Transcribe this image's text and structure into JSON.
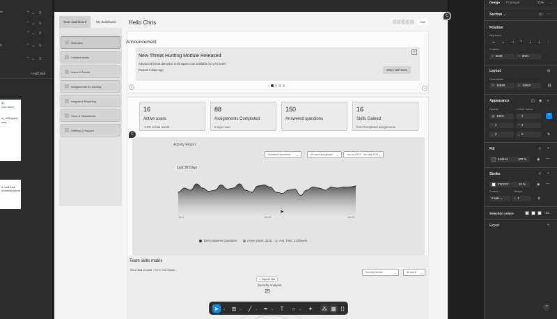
{
  "left_panel": {
    "add_task": "+ Add task",
    "fragments": [
      "sh",
      "",
      "",
      "",
      ""
    ]
  },
  "doc_snippets": {
    "first": [
      "3).",
      "over time),",
      "",
      "s), skill gaps),",
      "ress."
    ],
    "second": [
      "d, and their",
      "ommunications"
    ]
  },
  "app": {
    "sidebar": {
      "tab_active": "Team dashboard",
      "tab_inactive": "My dashboard",
      "items": [
        "Overview",
        "Content studio",
        "Users & Teams",
        "Assignments & Learning",
        "Insights & Reporting",
        "Tools & Simulations",
        "Settings & Support"
      ]
    },
    "greeting": "Hello Chris",
    "more_label": "Hide",
    "announcement": {
      "section_title": "Announcement",
      "headline": "New Threat Hunting Module Released",
      "description": "Advanced threat detection techniques now available for your team",
      "posted": "Posted 2 days ago",
      "share_button": "Share with team",
      "close_icon": "×",
      "prev_icon": "‹",
      "next_icon": "›"
    },
    "stats": [
      {
        "value": "16",
        "label": "Active users",
        "sub": "↑12% vs last month"
      },
      {
        "value": "88",
        "label": "Assignments Completed",
        "sub": "6.5 per user"
      },
      {
        "value": "150",
        "label": "Answered questions",
        "sub": ""
      },
      {
        "value": "16",
        "label": "Skills Gained",
        "sub": "from Completed assignments"
      }
    ],
    "activity": {
      "title": "Activity Report",
      "filters": [
        "Answered Questions",
        "All users and groups",
        "Jan 1st 2024 - Jan 31st 2024"
      ],
      "chart_title": "Last 30 Days",
      "legend": [
        "Total Answered Questions",
        "Active Users: 32/41",
        "Avg. Time: 3.5h/week"
      ]
    },
    "team": {
      "title": "Team skills matrix",
      "growth": "Team Skill Growth: +12% This Month",
      "filters": [
        "Security domain",
        "All users"
      ],
      "badge": "✓ Highest Skill",
      "skill_name": "Security Analysis",
      "skill_value": "25"
    }
  },
  "chart_data": {
    "type": "area",
    "title": "Last 30 Days",
    "x": [
      "Jan 1",
      "Jan 15",
      "Jan 30"
    ],
    "series": [
      {
        "values": [
          22,
          26,
          24,
          30,
          26,
          23,
          24,
          29,
          25,
          26,
          30,
          24,
          22,
          28,
          29,
          27,
          22,
          21,
          24,
          25,
          19,
          24,
          27,
          26,
          24,
          27,
          26,
          27,
          27,
          28
        ]
      }
    ],
    "ylim": [
      0,
      40
    ],
    "grid": false,
    "legend_position": "bottom"
  },
  "pins": [
    "C",
    "C"
  ],
  "props": {
    "tab_design": "Design",
    "tab_prototype": "Prototype",
    "zoom": "71%",
    "section_label": "Section",
    "position_title": "Position",
    "alignment_label": "Alignment",
    "position_label": "Position",
    "x_key": "X",
    "x_val": "6538",
    "y_key": "Y",
    "y_val": "9021",
    "layout_title": "Layout",
    "dimensions_label": "Dimensions",
    "w_key": "W",
    "w_val": "16928",
    "h_key": "H",
    "h_val": "10653",
    "appearance_title": "Appearance",
    "opacity_label": "Opacity",
    "opacity_val": "100%",
    "radius_label": "Corner radius",
    "radius_vals": [
      "2",
      "2",
      "2",
      "2"
    ],
    "fill_title": "Fill",
    "fill_hex": "444444",
    "fill_pct": "100",
    "fill_pct_unit": "%",
    "fill_color": "#444444",
    "stroke_title": "Stroke",
    "stroke_hex": "FFFFFF",
    "stroke_pct": "10",
    "stroke_pct_unit": "%",
    "stroke_color": "#FFFFFF",
    "stroke_position_label": "Position",
    "stroke_weight_label": "Weight",
    "stroke_position": "Inside",
    "stroke_weight": "1",
    "selection_colors_title": "Selection colors",
    "selection_more": "+53",
    "export_title": "Export",
    "help": "?"
  }
}
